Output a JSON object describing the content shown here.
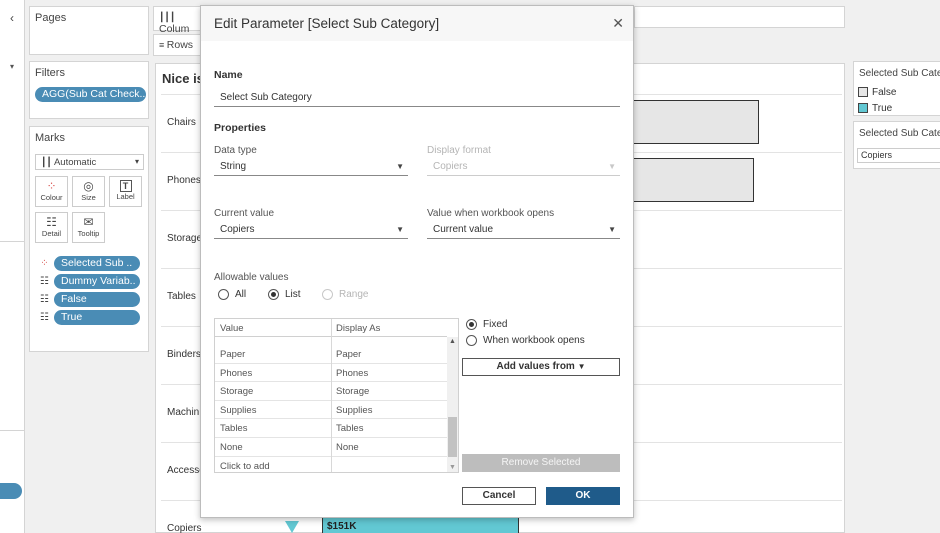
{
  "left_panels": {
    "pages_title": "Pages",
    "filters_title": "Filters",
    "filter_pill": "AGG(Sub Cat Check..",
    "marks_title": "Marks",
    "mark_type": "Automatic",
    "mark_buttons": [
      "Colour",
      "Size",
      "Label",
      "Detail",
      "Tooltip"
    ],
    "mark_pills": [
      "Selected Sub ..",
      "Dummy Variab..",
      "False",
      "True"
    ]
  },
  "shelves": {
    "columns": "Colum",
    "rows": "Rows"
  },
  "view": {
    "title": "Nice is",
    "categories": [
      "Chairs",
      "Phones",
      "Storage",
      "Tables",
      "Binders",
      "Machin",
      "Accesso",
      "Copiers"
    ],
    "copiers_label": "$151K"
  },
  "right_panels": {
    "legend_title": "Selected Sub Categ",
    "legend_items": [
      "False",
      "True"
    ],
    "legend_colors": [
      "#e6e6e6",
      "#62c8d3"
    ],
    "param_title": "Selected Sub Categor",
    "param_value": "Copiers"
  },
  "dialog": {
    "title": "Edit Parameter [Select Sub Category]",
    "name_label": "Name",
    "name_value": "Select Sub Category",
    "properties_label": "Properties",
    "data_type_label": "Data type",
    "data_type_value": "String",
    "display_format_label": "Display format",
    "display_format_value": "Copiers",
    "current_value_label": "Current value",
    "current_value": "Copiers",
    "value_when_opens_label": "Value when workbook opens",
    "value_when_opens": "Current value",
    "allowable_label": "Allowable values",
    "allowable_options": [
      "All",
      "List",
      "Range"
    ],
    "table_headers": [
      "Value",
      "Display As"
    ],
    "table_rows": [
      [
        "Paper",
        "Paper"
      ],
      [
        "Phones",
        "Phones"
      ],
      [
        "Storage",
        "Storage"
      ],
      [
        "Supplies",
        "Supplies"
      ],
      [
        "Tables",
        "Tables"
      ],
      [
        "None",
        "None"
      ],
      [
        "Click to add",
        ""
      ]
    ],
    "fixed_label": "Fixed",
    "when_opens_label": "When workbook opens",
    "add_values_label": "Add values from",
    "remove_label": "Remove Selected",
    "cancel_label": "Cancel",
    "ok_label": "OK"
  }
}
